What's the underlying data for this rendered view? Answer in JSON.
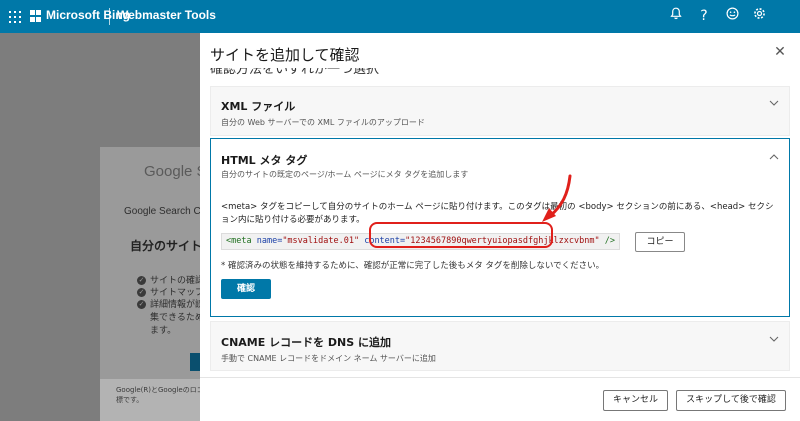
{
  "topbar": {
    "brand": "Microsoft Bing",
    "product": "Webmaster Tools",
    "icons": [
      "waffle-icon",
      "bell-icon",
      "help-icon",
      "smiley-icon",
      "gear-icon"
    ]
  },
  "background_page": {
    "google_logo": "Google S",
    "gsc_label": "Google Search Co",
    "heading": "自分のサイトを",
    "list_items": [
      "サイトの確認",
      "サイトマップ",
      "詳細情報が読",
      "集できるため",
      "ます。"
    ],
    "footer_text": [
      "Google(R)とGoogleのロゴ",
      "標です。"
    ]
  },
  "panel": {
    "title": "サイトを追加して確認",
    "subheading_partial": "確認方法をいずれか一つ選択",
    "sections": [
      {
        "title": "XML ファイル",
        "description": "自分の Web サーバーでの XML ファイルのアップロード",
        "expanded": false
      },
      {
        "title": "HTML メタ タグ",
        "description": "自分のサイトの既定のページ/ホーム ページにメタ タグを追加します",
        "expanded": true,
        "instructions": "<meta> タグをコピーして自分のサイトのホーム ページに貼り付けます。このタグは最初の <body> セクションの前にある、<head> セクション内に貼り付ける必要があります。",
        "meta_tag": {
          "open": "<meta",
          "name_attr": "name=",
          "name_value": "\"msvalidate.01\"",
          "content_attr": "content=",
          "content_value": "\"1234567890qwertyuiopasdfghjklzxcvbnm\"",
          "close": "/>"
        },
        "copy_label": "コピー",
        "note": "* 確認済みの状態を維持するために、確認が正常に完了した後もメタ タグを削除しないでください。",
        "verify_label": "確認"
      },
      {
        "title": "CNAME レコードを DNS に追加",
        "description": "手動で CNAME レコードをドメイン ネーム サーバーに追加",
        "expanded": false
      }
    ],
    "footer": {
      "cancel_label": "キャンセル",
      "skip_label": "スキップして後で確認"
    }
  },
  "colors": {
    "topbar": "#0078a8",
    "accent_border": "#0078a8",
    "annotation_red": "#e0201b"
  }
}
